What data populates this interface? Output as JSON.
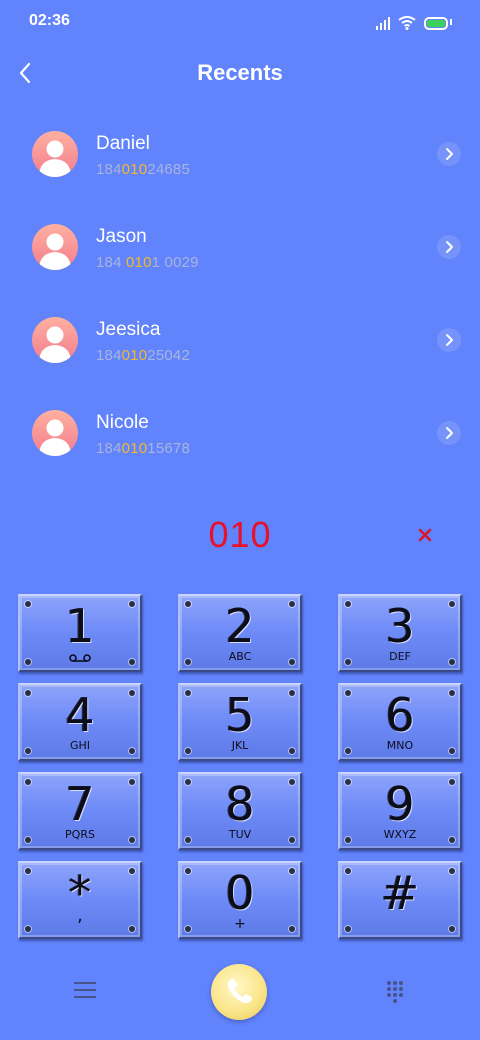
{
  "status_bar": {
    "time": "02:36",
    "signal_icon": "signal-bars-icon",
    "wifi_icon": "wifi-icon",
    "battery_icon": "battery-icon",
    "battery_color": "#3bd15a"
  },
  "header": {
    "title": "Recents",
    "back_icon": "chevron-left-icon"
  },
  "contacts": [
    {
      "name": "Daniel",
      "number_parts": [
        "184",
        "010",
        "24685"
      ]
    },
    {
      "name": "Jason",
      "number_parts": [
        "184 ",
        "010",
        "1 0029"
      ]
    },
    {
      "name": "Jeesica",
      "number_parts": [
        "184",
        "010",
        "25042"
      ]
    },
    {
      "name": "Nicole",
      "number_parts": [
        "184",
        "010",
        "15678"
      ]
    }
  ],
  "highlight_color": "#f5b829",
  "dialer": {
    "number": "010",
    "number_color": "#e8102a",
    "delete_icon": "close-icon"
  },
  "keypad": [
    {
      "digit": "1",
      "letters": ""
    },
    {
      "digit": "2",
      "letters": "ABC"
    },
    {
      "digit": "3",
      "letters": "DEF"
    },
    {
      "digit": "4",
      "letters": "GHI"
    },
    {
      "digit": "5",
      "letters": "JKL"
    },
    {
      "digit": "6",
      "letters": "MNO"
    },
    {
      "digit": "7",
      "letters": "PQRS"
    },
    {
      "digit": "8",
      "letters": "TUV"
    },
    {
      "digit": "9",
      "letters": "WXYZ"
    },
    {
      "digit": "*",
      "letters": ","
    },
    {
      "digit": "0",
      "letters": "+"
    },
    {
      "digit": "#",
      "letters": ""
    }
  ],
  "bottom_bar": {
    "menu_icon": "menu-icon",
    "call_icon": "phone-icon",
    "dialpad_icon": "dialpad-icon"
  },
  "colors": {
    "background": "#6183fb",
    "call_button": "#fbe68c"
  }
}
